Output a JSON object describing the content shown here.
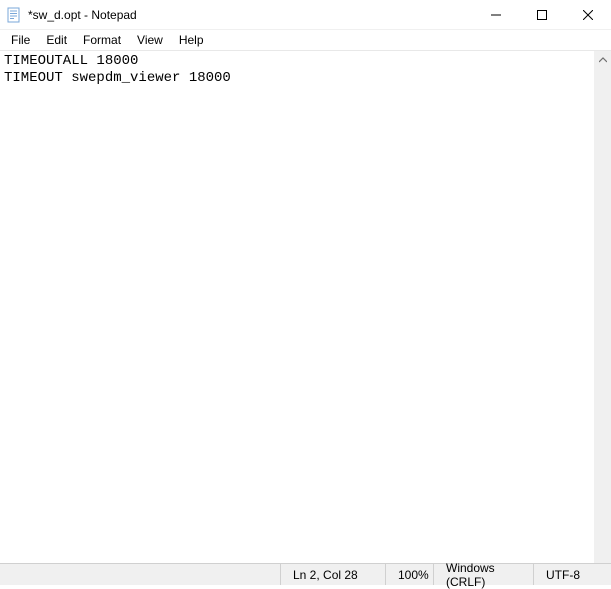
{
  "window": {
    "title": "*sw_d.opt - Notepad"
  },
  "menu": {
    "file": "File",
    "edit": "Edit",
    "format": "Format",
    "view": "View",
    "help": "Help"
  },
  "editor": {
    "content": "TIMEOUTALL 18000\nTIMEOUT swepdm_viewer 18000"
  },
  "status": {
    "cursor": "Ln 2, Col 28",
    "zoom": "100%",
    "eol": "Windows (CRLF)",
    "encoding": "UTF-8"
  }
}
